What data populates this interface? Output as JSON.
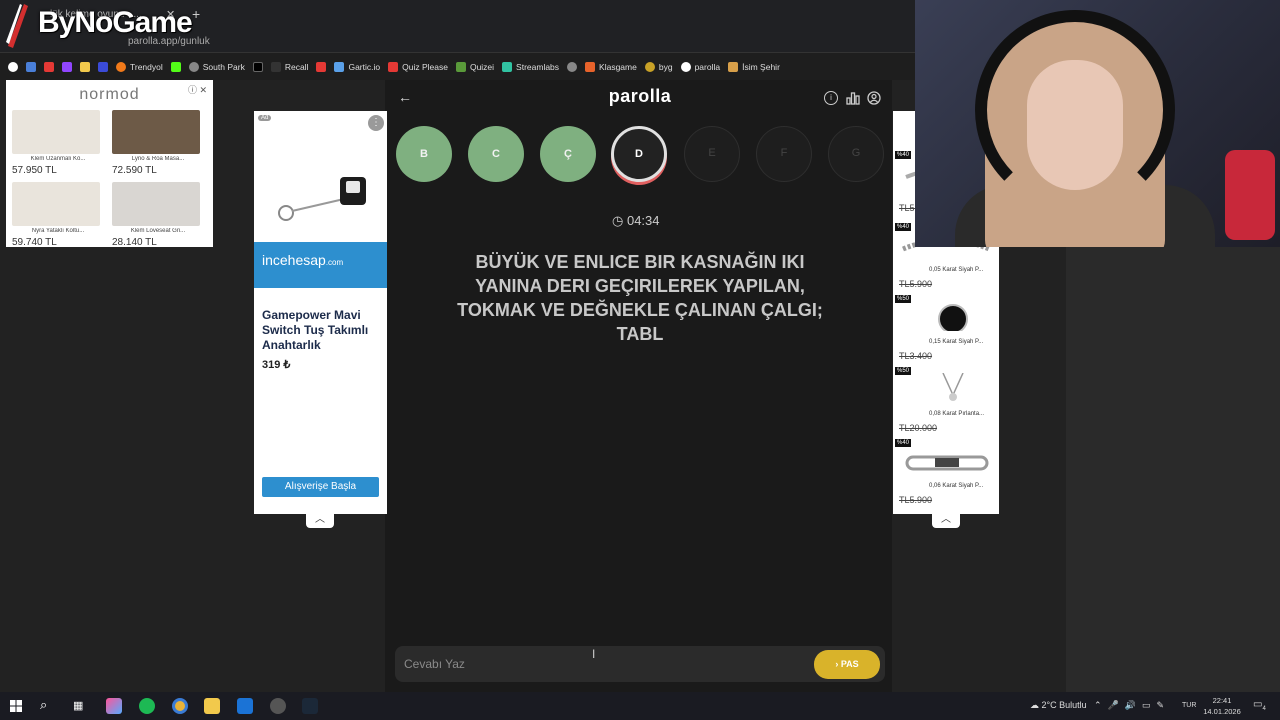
{
  "browser": {
    "tab_title": "lük kelime oyunu - ...",
    "url": "parolla.app/gunluk",
    "logo_text": "ByNoGame",
    "bookmarks": [
      "Trendyol",
      "South Park",
      "Recall",
      "Gartic.io",
      "Quiz Please",
      "Quizei",
      "Streamlabs",
      "Klasgame",
      "byg",
      "parolla",
      "İsim Şehir"
    ]
  },
  "ads": {
    "normod": {
      "brand": "normod",
      "products": [
        {
          "name": "Klem Uzanmalı Kö...",
          "price": "57.950 TL"
        },
        {
          "name": "Lyno & Roa Masa...",
          "price": "72.590 TL"
        },
        {
          "name": "Nyra Yataklı Koltu...",
          "price": "59.740 TL"
        },
        {
          "name": "Klem Loveseat Gri...",
          "price": "28.140 TL"
        }
      ]
    },
    "incehesap": {
      "badge": "Ad",
      "banner": "incehesap",
      "banner_suffix": ".com",
      "title": "Gamepower Mavi Switch Tuş Takımlı Anahtarlık",
      "price": "319 ₺",
      "button": "Alışverişe Başla"
    },
    "jewelry": [
      {
        "tag": "%40",
        "name": "",
        "price": "TL5."
      },
      {
        "tag": "%40",
        "name": "0,05 Karat Siyah P...",
        "price": "TL5.900"
      },
      {
        "tag": "%50",
        "name": "0,15 Karat Siyah P...",
        "price": "TL3.400"
      },
      {
        "tag": "%50",
        "name": "0,08 Karat Pırlanta...",
        "price": "TL20.000"
      },
      {
        "tag": "%40",
        "name": "0,06 Karat Siyah P...",
        "price": "TL5.900"
      }
    ]
  },
  "game": {
    "brand": "parolla",
    "letters": [
      {
        "char": "B",
        "state": "done"
      },
      {
        "char": "C",
        "state": "done"
      },
      {
        "char": "Ç",
        "state": "done"
      },
      {
        "char": "D",
        "state": "current"
      },
      {
        "char": "E",
        "state": "todo"
      },
      {
        "char": "F",
        "state": "todo"
      },
      {
        "char": "G",
        "state": "todo"
      }
    ],
    "timer": "04:34",
    "question": "BÜYÜK VE ENLICE BIR KASNAĞIN IKI YANINA DERI GEÇIRILEREK YAPILAN, TOKMAK VE DEĞNEKLE ÇALINAN ÇALGI; TABL",
    "input_placeholder": "Cevabı Yaz",
    "pass_label": "PAS"
  },
  "taskbar": {
    "weather": "2°C  Bulutlu",
    "lang": "TUR",
    "time": "22:41",
    "date": "14.01.2026",
    "notif_count": "4"
  },
  "colors": {
    "done_letter": "#7fb080",
    "pass_button": "#d9b32a",
    "ad_blue": "#2d8fcf"
  }
}
